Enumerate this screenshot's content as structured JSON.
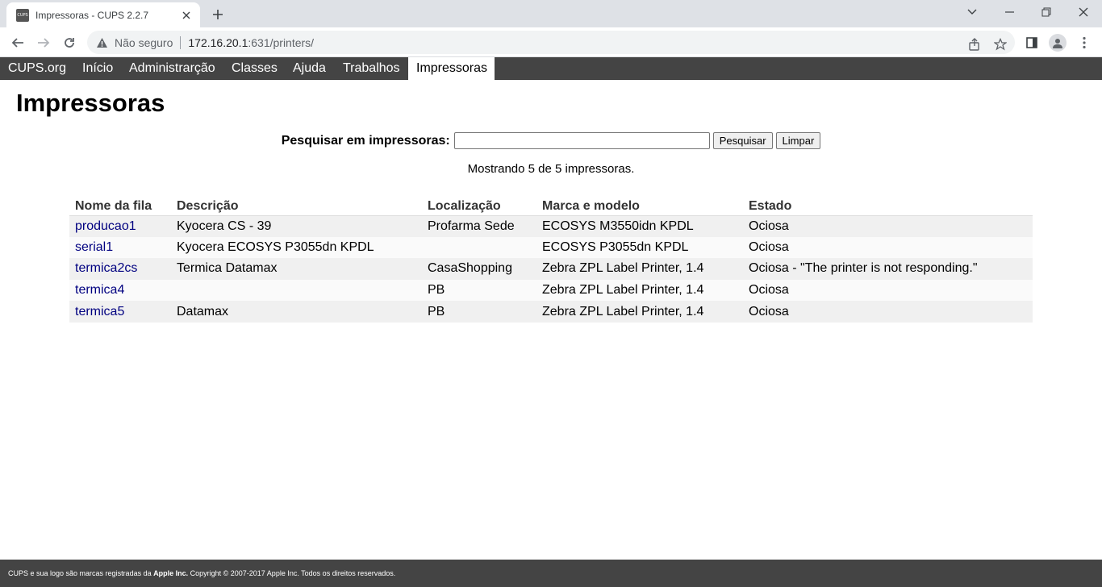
{
  "browser": {
    "tab_title": "Impressoras - CUPS 2.2.7",
    "favicon_text": "CUPS",
    "security_label": "Não seguro",
    "url_host": "172.16.20.1",
    "url_path": ":631/printers/"
  },
  "nav": {
    "items": [
      "CUPS.org",
      "Início",
      "Administrarção",
      "Classes",
      "Ajuda",
      "Trabalhos",
      "Impressoras"
    ],
    "active": "Impressoras"
  },
  "page": {
    "title": "Impressoras",
    "search_label": "Pesquisar em impressoras:",
    "search_value": "",
    "search_button": "Pesquisar",
    "clear_button": "Limpar",
    "showing_text": "Mostrando 5 de 5 impressoras."
  },
  "table": {
    "headers": [
      "Nome da fila",
      "Descrição",
      "Localização",
      "Marca e modelo",
      "Estado"
    ],
    "rows": [
      [
        "producao1",
        "Kyocera CS - 39",
        "Profarma Sede",
        "ECOSYS M3550idn KPDL",
        "Ociosa"
      ],
      [
        "serial1",
        "Kyocera ECOSYS P3055dn KPDL",
        "",
        "ECOSYS P3055dn KPDL",
        "Ociosa"
      ],
      [
        "termica2cs",
        "Termica Datamax",
        "CasaShopping",
        "Zebra ZPL Label Printer, 1.4",
        "Ociosa - \"The printer is not responding.\""
      ],
      [
        "termica4",
        "",
        "PB",
        "Zebra ZPL Label Printer, 1.4",
        "Ociosa"
      ],
      [
        "termica5",
        "Datamax",
        "PB",
        "Zebra ZPL Label Printer, 1.4",
        "Ociosa"
      ]
    ]
  },
  "footer": {
    "text_before": "CUPS e sua logo são marcas registradas da ",
    "company": "Apple Inc.",
    "text_after": " Copyright © 2007-2017 Apple Inc. Todos os direitos reservados."
  },
  "colors": {
    "nav_bg": "#444444",
    "link": "#000080",
    "chrome_bg": "#dee1e6"
  }
}
